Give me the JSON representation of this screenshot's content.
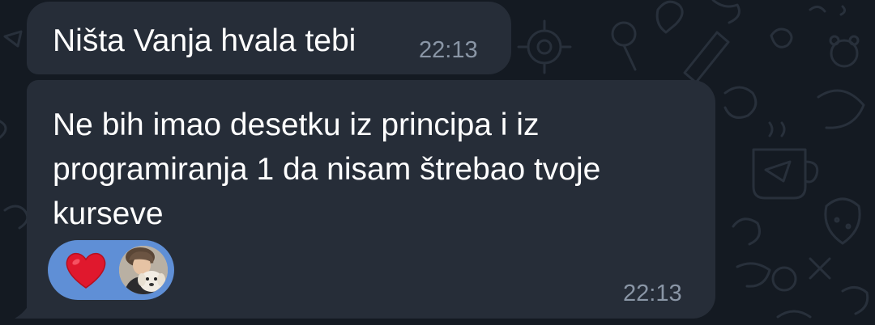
{
  "messages": [
    {
      "text": "Ništa Vanja hvala tebi",
      "time": "22:13"
    },
    {
      "text": "Ne bih imao desetku iz principa i iz programiranja 1 da nisam štrebao tvoje kurseve",
      "time": "22:13",
      "reactions": [
        {
          "emoji": "heart-icon",
          "avatar": "reactor-avatar"
        }
      ]
    }
  ],
  "colors": {
    "background": "#141a22",
    "bubble": "#262d38",
    "text": "#ffffff",
    "timestamp": "#8a96a6",
    "reaction_pill": "#5f8fd6",
    "heart": "#e0182d"
  }
}
